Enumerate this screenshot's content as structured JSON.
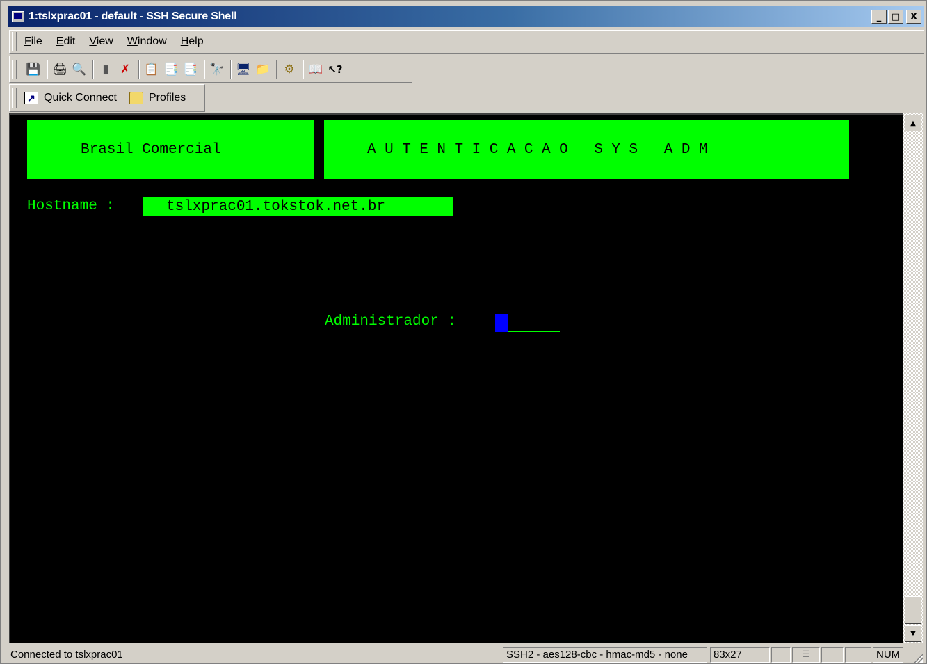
{
  "window": {
    "title": "1:tslxprac01 - default - SSH Secure Shell",
    "minimize": "_",
    "maximize": "□",
    "close": "X"
  },
  "menu": [
    {
      "label": "File",
      "ul": "F",
      "rest": "ile"
    },
    {
      "label": "Edit",
      "ul": "E",
      "rest": "dit"
    },
    {
      "label": "View",
      "ul": "V",
      "rest": "iew"
    },
    {
      "label": "Window",
      "ul": "W",
      "rest": "indow"
    },
    {
      "label": "Help",
      "ul": "H",
      "rest": "elp"
    }
  ],
  "toolbar": {
    "icons": [
      "save-icon",
      "print-icon",
      "print-preview-icon",
      "disconnect-icon",
      "reconnect-icon",
      "copy-icon",
      "paste-icon",
      "paste-alt-icon",
      "find-icon",
      "new-terminal-icon",
      "new-file-transfer-icon",
      "settings-icon",
      "help-book-icon",
      "context-help-icon"
    ]
  },
  "quickbar": {
    "quick_connect": "Quick Connect",
    "profiles": "Profiles"
  },
  "terminal": {
    "banner_left": "Brasil Comercial",
    "banner_right": "AUTENTICACAO SYS ADM",
    "host_label": "Hostname :",
    "host_value": "tslxprac01.tokstok.net.br",
    "admin_label": "Administrador :",
    "admin_value": ""
  },
  "colors": {
    "terminal_bg": "#000000",
    "terminal_fg": "#00ff00",
    "cursor": "#0000ff",
    "title_start": "#0a246a",
    "title_end": "#a6caf0"
  },
  "status": {
    "connection": "Connected to tslxprac01",
    "crypto": "SSH2 - aes128-cbc - hmac-md5 - none",
    "size": "83x27",
    "num": "NUM"
  }
}
